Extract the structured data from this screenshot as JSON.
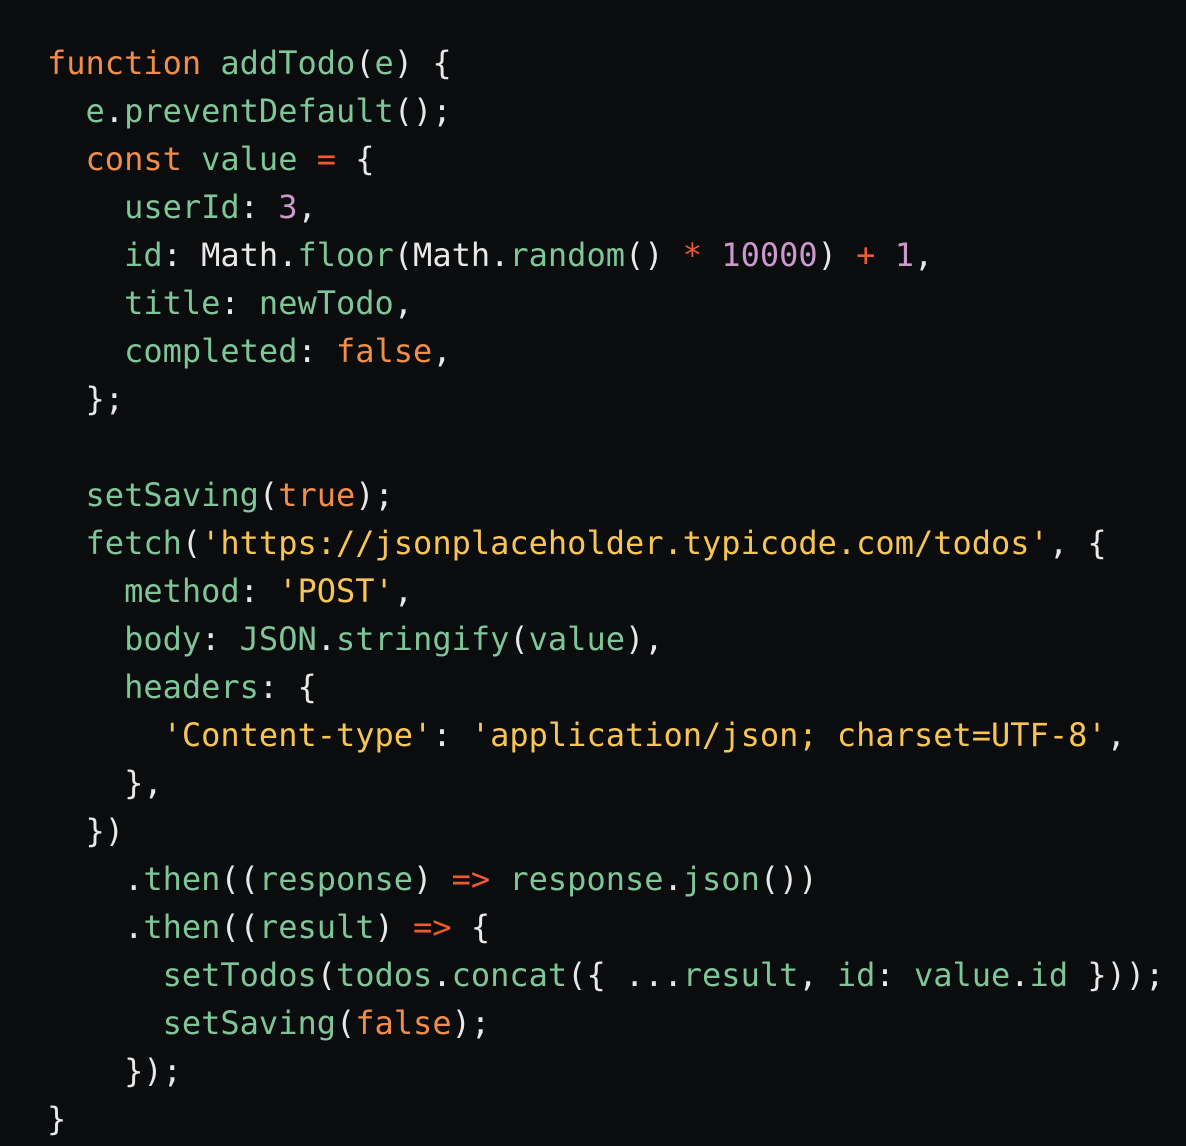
{
  "colors": {
    "background": "#0b0c0e",
    "plain": "#e8e8e8",
    "keyword": "#f08d49",
    "function": "#7ec699",
    "property": "#7ec699",
    "string": "#f8c555",
    "number": "#cc99cd",
    "operator": "#f25a2c",
    "punctuation": "#e8e8e8"
  },
  "code_lines": [
    [
      [
        "keyword",
        "function"
      ],
      [
        "plain",
        " "
      ],
      [
        "function",
        "addTodo"
      ],
      [
        "punctuation",
        "("
      ],
      [
        "function",
        "e"
      ],
      [
        "punctuation",
        ")"
      ],
      [
        "plain",
        " "
      ],
      [
        "punctuation",
        "{"
      ]
    ],
    [
      [
        "plain",
        "  "
      ],
      [
        "function",
        "e"
      ],
      [
        "punctuation",
        "."
      ],
      [
        "function",
        "preventDefault"
      ],
      [
        "punctuation",
        "();"
      ]
    ],
    [
      [
        "plain",
        "  "
      ],
      [
        "keyword",
        "const"
      ],
      [
        "plain",
        " "
      ],
      [
        "function",
        "value"
      ],
      [
        "plain",
        " "
      ],
      [
        "operator",
        "="
      ],
      [
        "plain",
        " "
      ],
      [
        "punctuation",
        "{"
      ]
    ],
    [
      [
        "plain",
        "    "
      ],
      [
        "property",
        "userId"
      ],
      [
        "punctuation",
        ":"
      ],
      [
        "plain",
        " "
      ],
      [
        "number",
        "3"
      ],
      [
        "punctuation",
        ","
      ]
    ],
    [
      [
        "plain",
        "    "
      ],
      [
        "property",
        "id"
      ],
      [
        "punctuation",
        ":"
      ],
      [
        "plain",
        " Math"
      ],
      [
        "punctuation",
        "."
      ],
      [
        "function",
        "floor"
      ],
      [
        "punctuation",
        "("
      ],
      [
        "plain",
        "Math"
      ],
      [
        "punctuation",
        "."
      ],
      [
        "function",
        "random"
      ],
      [
        "punctuation",
        "()"
      ],
      [
        "plain",
        " "
      ],
      [
        "operator",
        "*"
      ],
      [
        "plain",
        " "
      ],
      [
        "number",
        "10000"
      ],
      [
        "punctuation",
        ")"
      ],
      [
        "plain",
        " "
      ],
      [
        "operator",
        "+"
      ],
      [
        "plain",
        " "
      ],
      [
        "number",
        "1"
      ],
      [
        "punctuation",
        ","
      ]
    ],
    [
      [
        "plain",
        "    "
      ],
      [
        "property",
        "title"
      ],
      [
        "punctuation",
        ":"
      ],
      [
        "plain",
        " "
      ],
      [
        "function",
        "newTodo"
      ],
      [
        "punctuation",
        ","
      ]
    ],
    [
      [
        "plain",
        "    "
      ],
      [
        "property",
        "completed"
      ],
      [
        "punctuation",
        ":"
      ],
      [
        "plain",
        " "
      ],
      [
        "keyword",
        "false"
      ],
      [
        "punctuation",
        ","
      ]
    ],
    [
      [
        "plain",
        "  "
      ],
      [
        "punctuation",
        "};"
      ]
    ],
    [],
    [
      [
        "plain",
        "  "
      ],
      [
        "function",
        "setSaving"
      ],
      [
        "punctuation",
        "("
      ],
      [
        "keyword",
        "true"
      ],
      [
        "punctuation",
        ");"
      ]
    ],
    [
      [
        "plain",
        "  "
      ],
      [
        "function",
        "fetch"
      ],
      [
        "punctuation",
        "("
      ],
      [
        "string",
        "'https://jsonplaceholder.typicode.com/todos'"
      ],
      [
        "punctuation",
        ","
      ],
      [
        "plain",
        " "
      ],
      [
        "punctuation",
        "{"
      ]
    ],
    [
      [
        "plain",
        "    "
      ],
      [
        "property",
        "method"
      ],
      [
        "punctuation",
        ":"
      ],
      [
        "plain",
        " "
      ],
      [
        "string",
        "'POST'"
      ],
      [
        "punctuation",
        ","
      ]
    ],
    [
      [
        "plain",
        "    "
      ],
      [
        "property",
        "body"
      ],
      [
        "punctuation",
        ":"
      ],
      [
        "plain",
        " "
      ],
      [
        "function",
        "JSON"
      ],
      [
        "punctuation",
        "."
      ],
      [
        "function",
        "stringify"
      ],
      [
        "punctuation",
        "("
      ],
      [
        "function",
        "value"
      ],
      [
        "punctuation",
        "),"
      ]
    ],
    [
      [
        "plain",
        "    "
      ],
      [
        "property",
        "headers"
      ],
      [
        "punctuation",
        ":"
      ],
      [
        "plain",
        " "
      ],
      [
        "punctuation",
        "{"
      ]
    ],
    [
      [
        "plain",
        "      "
      ],
      [
        "string",
        "'Content-type'"
      ],
      [
        "punctuation",
        ":"
      ],
      [
        "plain",
        " "
      ],
      [
        "string",
        "'application/json; charset=UTF-8'"
      ],
      [
        "punctuation",
        ","
      ]
    ],
    [
      [
        "plain",
        "    "
      ],
      [
        "punctuation",
        "},"
      ]
    ],
    [
      [
        "plain",
        "  "
      ],
      [
        "punctuation",
        "})"
      ]
    ],
    [
      [
        "plain",
        "    "
      ],
      [
        "punctuation",
        "."
      ],
      [
        "function",
        "then"
      ],
      [
        "punctuation",
        "(("
      ],
      [
        "function",
        "response"
      ],
      [
        "punctuation",
        ")"
      ],
      [
        "plain",
        " "
      ],
      [
        "operator",
        "=>"
      ],
      [
        "plain",
        " "
      ],
      [
        "function",
        "response"
      ],
      [
        "punctuation",
        "."
      ],
      [
        "function",
        "json"
      ],
      [
        "punctuation",
        "())"
      ]
    ],
    [
      [
        "plain",
        "    "
      ],
      [
        "punctuation",
        "."
      ],
      [
        "function",
        "then"
      ],
      [
        "punctuation",
        "(("
      ],
      [
        "function",
        "result"
      ],
      [
        "punctuation",
        ")"
      ],
      [
        "plain",
        " "
      ],
      [
        "operator",
        "=>"
      ],
      [
        "plain",
        " "
      ],
      [
        "punctuation",
        "{"
      ]
    ],
    [
      [
        "plain",
        "      "
      ],
      [
        "function",
        "setTodos"
      ],
      [
        "punctuation",
        "("
      ],
      [
        "function",
        "todos"
      ],
      [
        "punctuation",
        "."
      ],
      [
        "function",
        "concat"
      ],
      [
        "punctuation",
        "({"
      ],
      [
        "plain",
        " "
      ],
      [
        "punctuation",
        "..."
      ],
      [
        "function",
        "result"
      ],
      [
        "punctuation",
        ","
      ],
      [
        "plain",
        " "
      ],
      [
        "property",
        "id"
      ],
      [
        "punctuation",
        ":"
      ],
      [
        "plain",
        " "
      ],
      [
        "function",
        "value"
      ],
      [
        "punctuation",
        "."
      ],
      [
        "function",
        "id"
      ],
      [
        "plain",
        " "
      ],
      [
        "punctuation",
        "}));"
      ]
    ],
    [
      [
        "plain",
        "      "
      ],
      [
        "function",
        "setSaving"
      ],
      [
        "punctuation",
        "("
      ],
      [
        "keyword",
        "false"
      ],
      [
        "punctuation",
        ");"
      ]
    ],
    [
      [
        "plain",
        "    "
      ],
      [
        "punctuation",
        "});"
      ]
    ],
    [
      [
        "punctuation",
        "}"
      ]
    ]
  ]
}
